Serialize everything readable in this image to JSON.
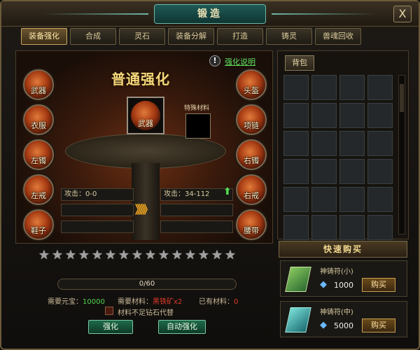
{
  "window": {
    "title": "锻造",
    "close_label": "X"
  },
  "tabs": [
    {
      "label": "装备强化",
      "active": true
    },
    {
      "label": "合成",
      "active": false
    },
    {
      "label": "灵石",
      "active": false
    },
    {
      "label": "装备分解",
      "active": false
    },
    {
      "label": "打造",
      "active": false
    },
    {
      "label": "铸灵",
      "active": false
    },
    {
      "label": "兽魂回收",
      "active": false
    }
  ],
  "enhance": {
    "help_icon": "!",
    "help_link": "强化说明",
    "heading": "普通强化",
    "left_slots": [
      "武器",
      "衣服",
      "左镯",
      "左戒",
      "鞋子"
    ],
    "right_slots": [
      "头盔",
      "项链",
      "右镯",
      "右戒",
      "腰带"
    ],
    "main_item": "武器",
    "special_material_label": "特殊材料",
    "attack_before": "攻击：0-0",
    "attack_after": "攻击：34-112",
    "arrow_mark": "》》》",
    "up_arrow": "⬆",
    "stars_total": 15,
    "stars_filled": 0,
    "progress_text": "0/60",
    "progress_value": 0,
    "progress_max": 60,
    "need_yuanbao_label": "需要元宝：",
    "need_yuanbao_value": "10000",
    "need_material_label": "需要材料：",
    "need_material_value": "黑铁矿x2",
    "have_material_label": "已有材料：",
    "have_material_value": "0",
    "checkbox_label": "材料不足钻石代替",
    "btn_enhance": "强化",
    "btn_auto": "自动强化"
  },
  "bag": {
    "tab_label": "背包",
    "rows": 6,
    "cols": 4
  },
  "quick_buy": {
    "header": "快速购买",
    "items": [
      {
        "name": "神铸符(小)",
        "price": "1000",
        "buy_label": "购买",
        "icon": "green-talisman-icon"
      },
      {
        "name": "神铸符(中)",
        "price": "5000",
        "buy_label": "购买",
        "icon": "teal-talisman-icon"
      }
    ]
  },
  "colors": {
    "accent_green": "#52e052",
    "gold": "#f5d77a",
    "red": "#e03a2a"
  }
}
